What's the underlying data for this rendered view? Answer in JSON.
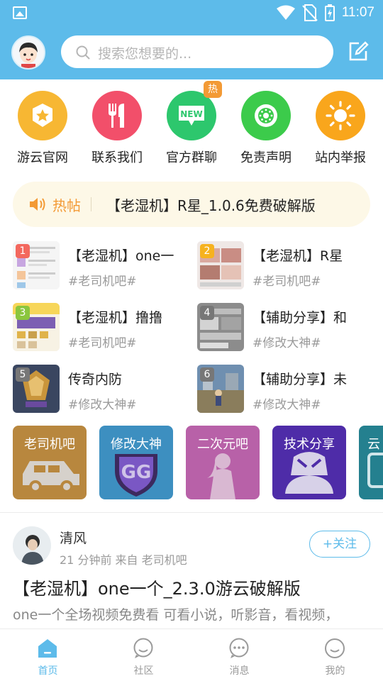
{
  "status_bar": {
    "time": "11:07"
  },
  "search": {
    "placeholder": "搜索您想要的..."
  },
  "quick_links": [
    {
      "label": "游云官网",
      "icon": "star-badge-icon",
      "color": "#f7b733"
    },
    {
      "label": "联系我们",
      "icon": "fork-knife-icon",
      "color": "#f24f6a"
    },
    {
      "label": "官方群聊",
      "icon": "new-badge-icon",
      "color": "#2dc76d",
      "badge": "热"
    },
    {
      "label": "免责声明",
      "icon": "kiwi-icon",
      "color": "#3ccb4b"
    },
    {
      "label": "站内举报",
      "icon": "sun-icon",
      "color": "#f9a61c"
    }
  ],
  "hot": {
    "label": "热帖",
    "text": "【老湿机】R星_1.0.6免费破解版"
  },
  "posts": [
    {
      "rank": "1",
      "title": "【老湿机】one一",
      "tag": "#老司机吧#",
      "rank_color": "#f3685e"
    },
    {
      "rank": "2",
      "title": "【老湿机】R星",
      "tag": "#老司机吧#",
      "rank_color": "#f6b21f"
    },
    {
      "rank": "3",
      "title": "【老湿机】撸撸",
      "tag": "#老司机吧#",
      "rank_color": "#8bc63e"
    },
    {
      "rank": "4",
      "title": "【辅助分享】和",
      "tag": "#修改大神#",
      "rank_color": "#777777"
    },
    {
      "rank": "5",
      "title": "传奇内防",
      "tag": "#修改大神#",
      "rank_color": "#777777"
    },
    {
      "rank": "6",
      "title": "【辅助分享】未",
      "tag": "#修改大神#",
      "rank_color": "#777777"
    }
  ],
  "categories": [
    {
      "label": "老司机吧",
      "color": "#b8873e",
      "icon": "car-icon"
    },
    {
      "label": "修改大神",
      "color": "#3d8fc0",
      "icon": "gg-shield-icon"
    },
    {
      "label": "二次元吧",
      "color": "#b861a8",
      "icon": "anime-girl-icon"
    },
    {
      "label": "技术分享",
      "color": "#4e2ca8",
      "icon": "hacker-icon"
    },
    {
      "label": "云",
      "color": "#24808f",
      "icon": "phone-icon"
    }
  ],
  "feed_post": {
    "author": "清风",
    "meta": "21 分钟前  来自 老司机吧",
    "follow_label": "+关注",
    "title": "【老湿机】one一个_2.3.0游云破解版",
    "excerpt": "one一个全场视频免费看 可看小说，听影音，看视频，"
  },
  "tabs": [
    {
      "label": "首页",
      "icon": "home-icon",
      "active": true
    },
    {
      "label": "社区",
      "icon": "community-icon"
    },
    {
      "label": "消息",
      "icon": "message-icon"
    },
    {
      "label": "我的",
      "icon": "profile-icon"
    }
  ],
  "colors": {
    "primary": "#5dbbea",
    "hot": "#f39a35"
  }
}
